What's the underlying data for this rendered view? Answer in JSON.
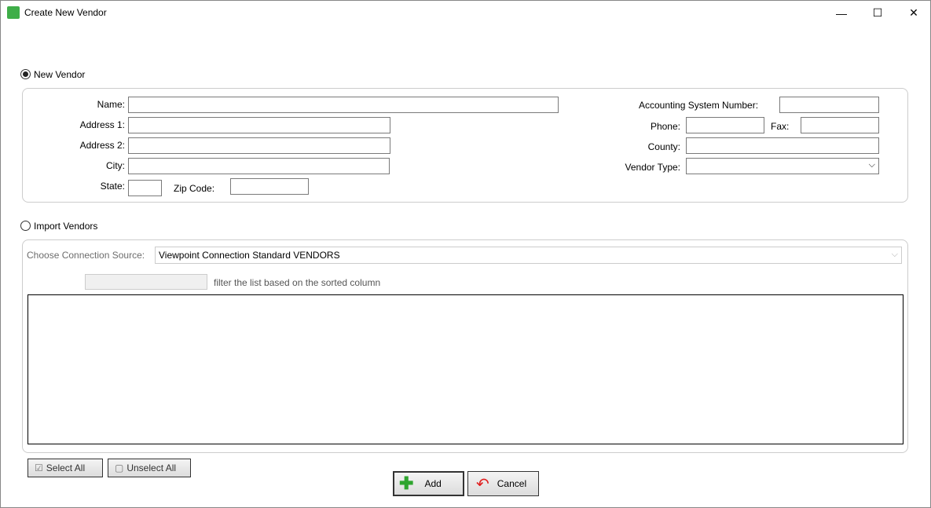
{
  "window": {
    "title": "Create New Vendor",
    "minimize": "—",
    "maximize": "☐",
    "close": "✕"
  },
  "new_vendor": {
    "label": "New Vendor",
    "selected": true,
    "name_label": "Name:",
    "address1_label": "Address 1:",
    "address2_label": "Address 2:",
    "city_label": "City:",
    "state_label": "State:",
    "zip_label": "Zip Code:",
    "acct_label": "Accounting System Number:",
    "phone_label": "Phone:",
    "fax_label": "Fax:",
    "county_label": "County:",
    "vendor_type_label": "Vendor Type:"
  },
  "import_vendors": {
    "label": "Import Vendors",
    "selected": false,
    "source_label": "Choose Connection Source:",
    "source_value": "Viewpoint Connection Standard VENDORS",
    "filter_hint": "filter the list based on the sorted column"
  },
  "buttons": {
    "select_all": "Select All",
    "unselect_all": "Unselect All",
    "add": "Add",
    "cancel": "Cancel"
  }
}
